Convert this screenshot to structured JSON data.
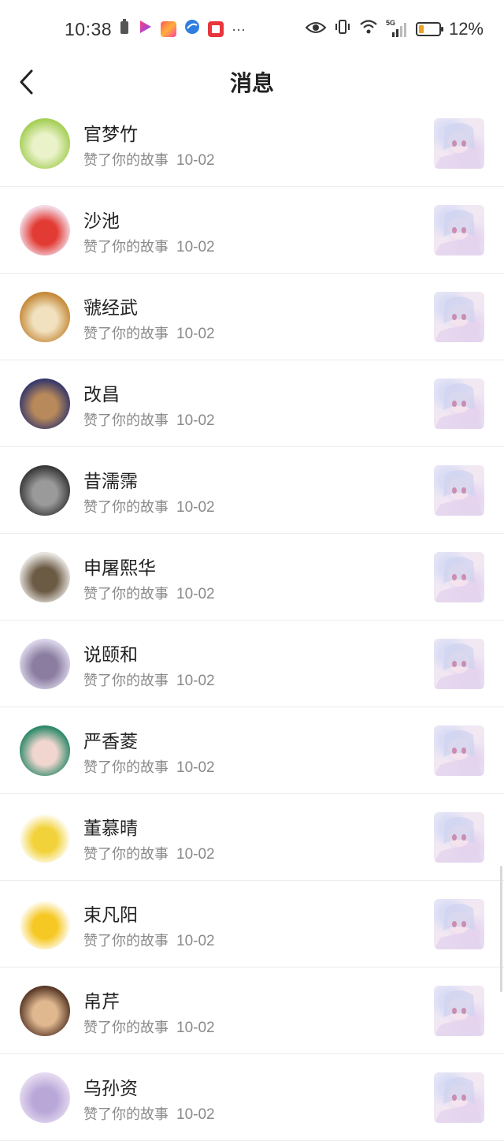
{
  "status_bar": {
    "time": "10:38",
    "network": "5G",
    "battery_percent": "12%",
    "battery_level": 0.12,
    "battery_color": "#f0a020",
    "notification_icons": [
      "battery-saver-icon",
      "video-app-icon",
      "ecommerce-app-icon",
      "browser-icon",
      "book-app-icon"
    ],
    "more": "···"
  },
  "header": {
    "title": "消息",
    "back_icon": "chevron-left-icon"
  },
  "messages": [
    {
      "name": "官梦竹",
      "action": "赞了你的故事",
      "date": "10-02",
      "avatar_colors": [
        "#a6cf58",
        "#e9f2c9"
      ]
    },
    {
      "name": "沙池",
      "action": "赞了你的故事",
      "date": "10-02",
      "avatar_colors": [
        "#f3d9e4",
        "#e23b33"
      ]
    },
    {
      "name": "虢经武",
      "action": "赞了你的故事",
      "date": "10-02",
      "avatar_colors": [
        "#c58a3a",
        "#f1e1bf"
      ]
    },
    {
      "name": "改昌",
      "action": "赞了你的故事",
      "date": "10-02",
      "avatar_colors": [
        "#3a3a6a",
        "#b8895a"
      ]
    },
    {
      "name": "昔濡霈",
      "action": "赞了你的故事",
      "date": "10-02",
      "avatar_colors": [
        "#3a3a3a",
        "#9a9a9a"
      ]
    },
    {
      "name": "申屠熙华",
      "action": "赞了你的故事",
      "date": "10-02",
      "avatar_colors": [
        "#e6e3de",
        "#6b5a44"
      ]
    },
    {
      "name": "说颐和",
      "action": "赞了你的故事",
      "date": "10-02",
      "avatar_colors": [
        "#d9d3e8",
        "#8a7da0"
      ]
    },
    {
      "name": "严香菱",
      "action": "赞了你的故事",
      "date": "10-02",
      "avatar_colors": [
        "#2f8a6a",
        "#f0d6cf"
      ]
    },
    {
      "name": "董慕晴",
      "action": "赞了你的故事",
      "date": "10-02",
      "avatar_colors": [
        "#ffffff",
        "#f2d23a"
      ]
    },
    {
      "name": "束凡阳",
      "action": "赞了你的故事",
      "date": "10-02",
      "avatar_colors": [
        "#ffffff",
        "#f6c824"
      ]
    },
    {
      "name": "帛芹",
      "action": "赞了你的故事",
      "date": "10-02",
      "avatar_colors": [
        "#5a3a28",
        "#e0b890"
      ]
    },
    {
      "name": "乌孙资",
      "action": "赞了你的故事",
      "date": "10-02",
      "avatar_colors": [
        "#e4d9f0",
        "#b9a7d8"
      ]
    }
  ]
}
